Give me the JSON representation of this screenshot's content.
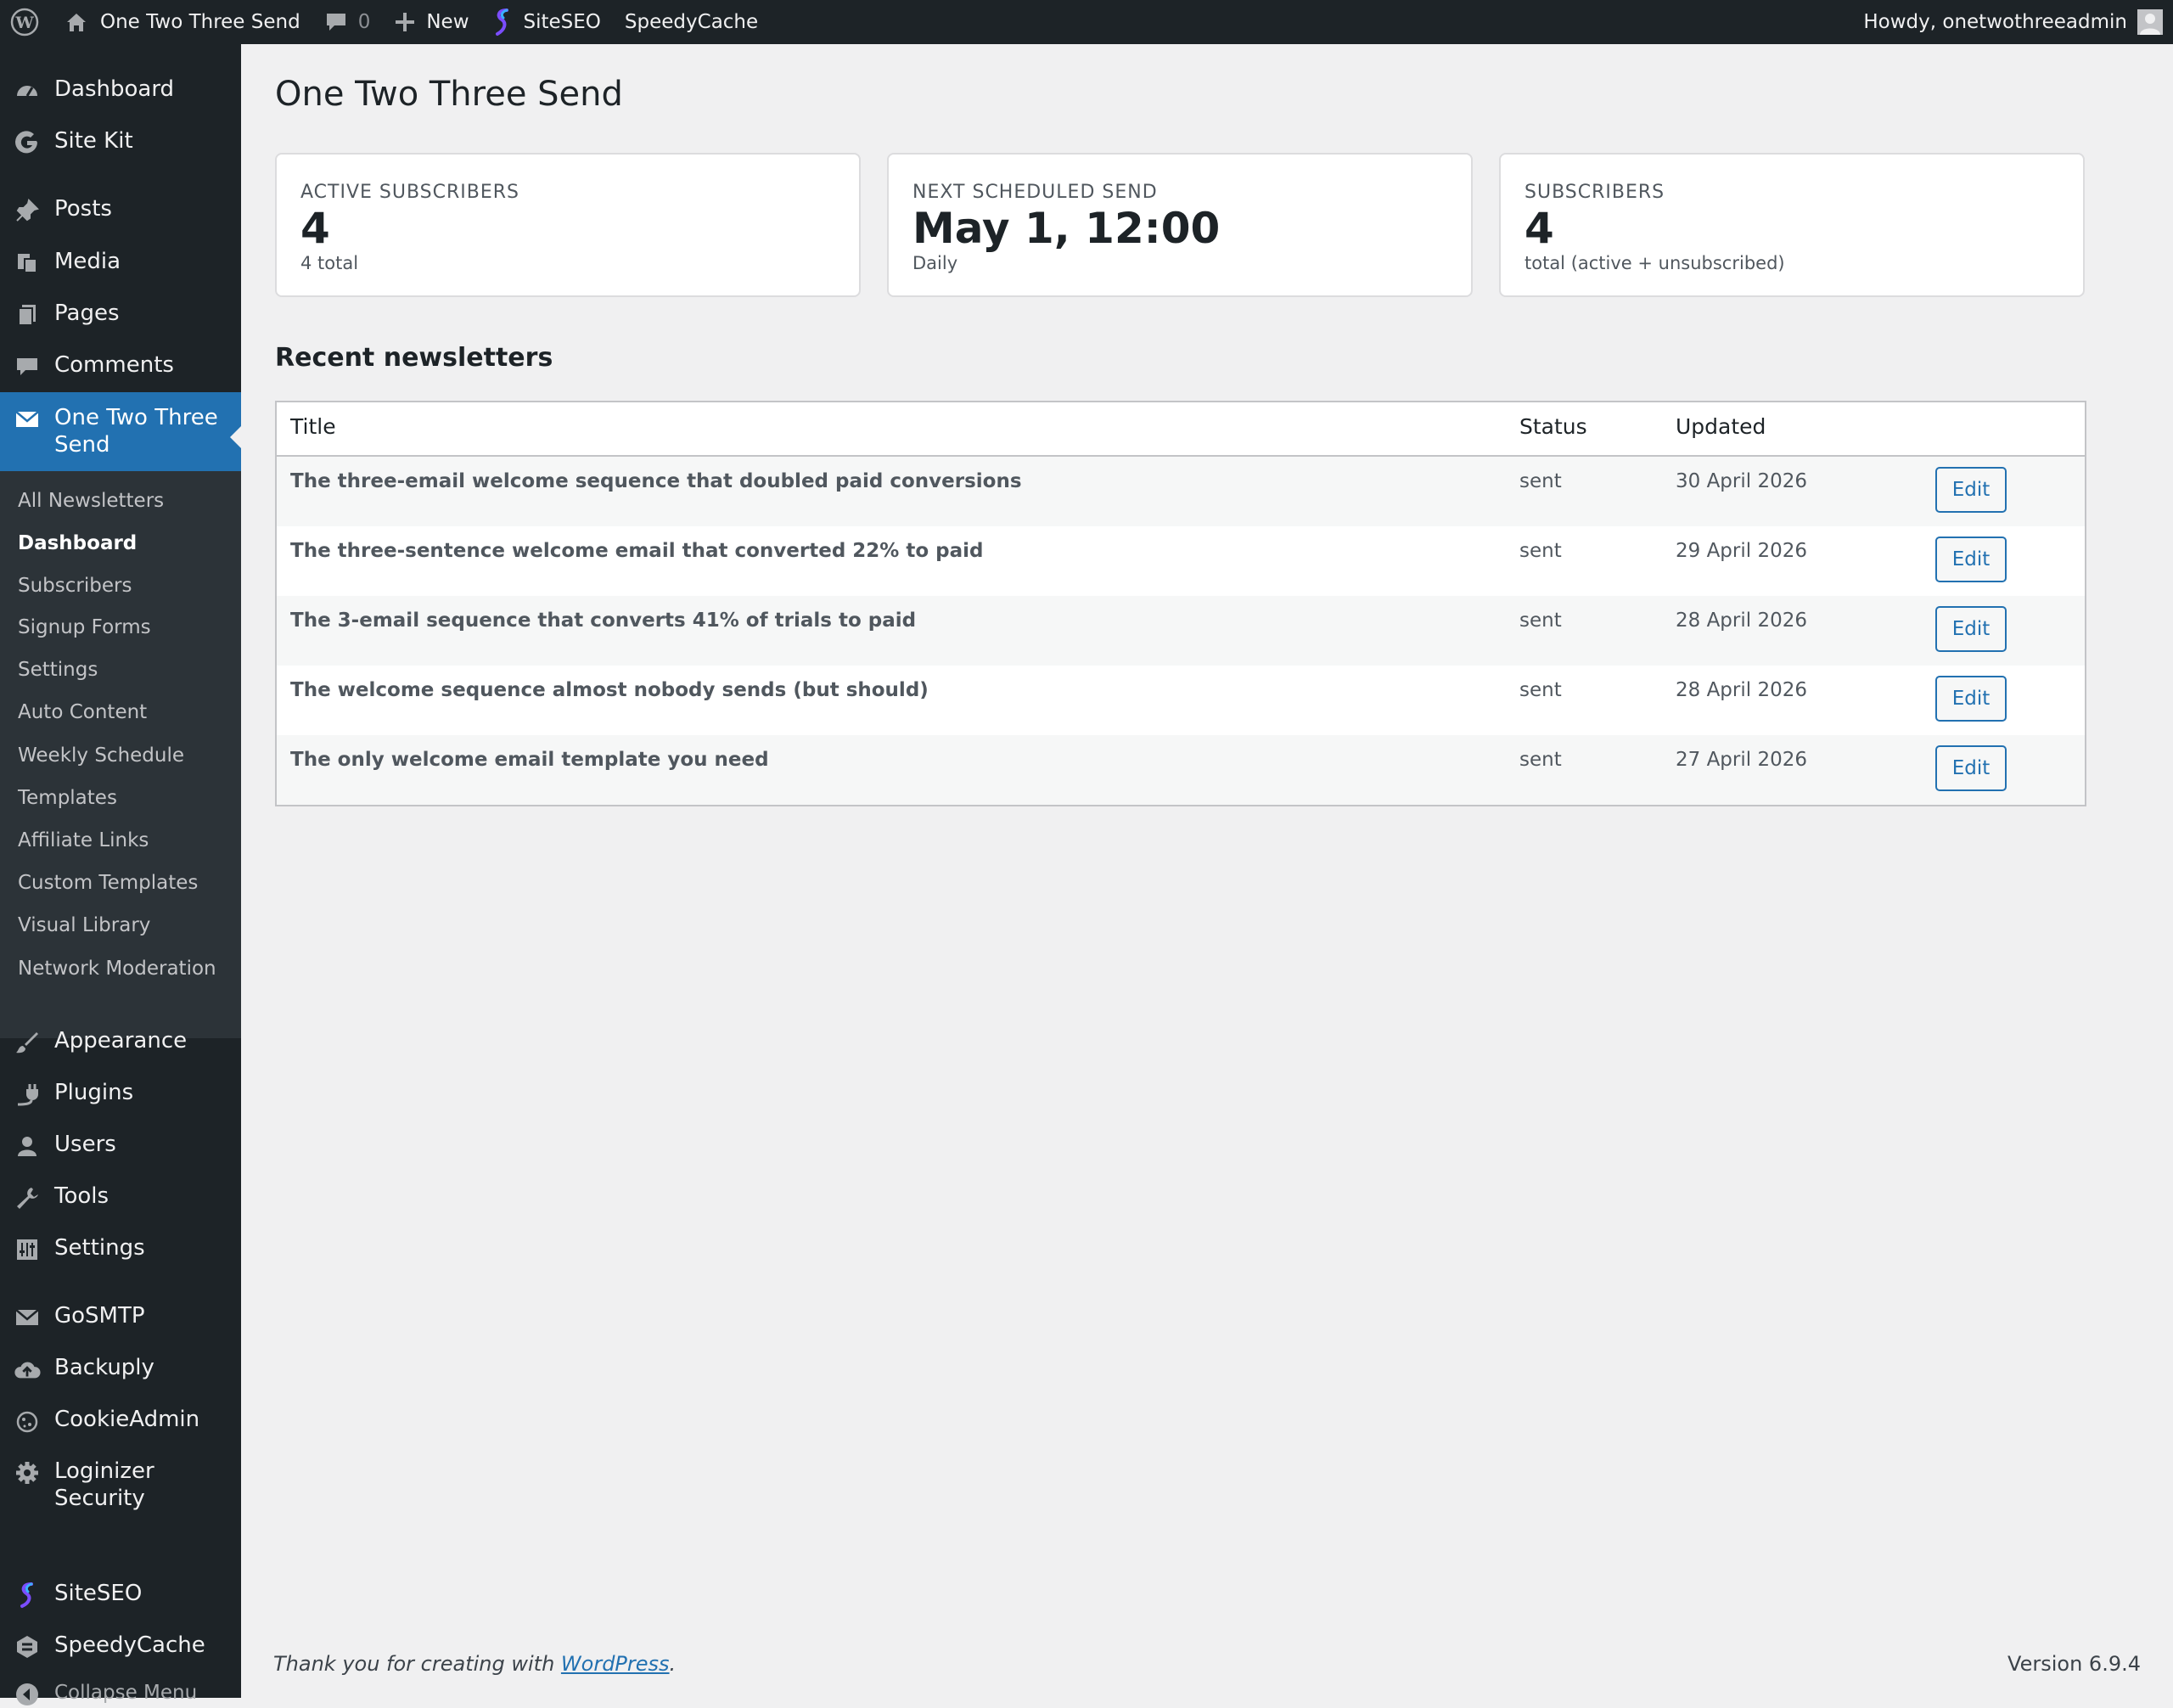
{
  "adminbar": {
    "site_name": "One Two Three Send",
    "comments_count": "0",
    "new_label": "New",
    "siteseo_label": "SiteSEO",
    "speedycache_label": "SpeedyCache",
    "greeting": "Howdy, onetwothreeadmin"
  },
  "sidebar": {
    "items_top": [
      {
        "label": "Dashboard",
        "icon": "dashboard-icon"
      },
      {
        "label": "Site Kit",
        "icon": "google-g-icon"
      },
      {
        "label": "Posts",
        "icon": "pushpin-icon"
      },
      {
        "label": "Media",
        "icon": "media-icon"
      },
      {
        "label": "Pages",
        "icon": "pages-icon"
      },
      {
        "label": "Comments",
        "icon": "comment-icon"
      },
      {
        "label": "One Two Three Send",
        "icon": "envelope-icon"
      }
    ],
    "submenu": [
      "All Newsletters",
      "Dashboard",
      "Subscribers",
      "Signup Forms",
      "Settings",
      "Auto Content",
      "Weekly Schedule",
      "Templates",
      "Affiliate Links",
      "Custom Templates",
      "Visual Library",
      "Network Moderation"
    ],
    "items_bottom": [
      {
        "label": "Appearance",
        "icon": "brush-icon"
      },
      {
        "label": "Plugins",
        "icon": "plug-icon"
      },
      {
        "label": "Users",
        "icon": "user-icon"
      },
      {
        "label": "Tools",
        "icon": "wrench-icon"
      },
      {
        "label": "Settings",
        "icon": "settings-icon"
      },
      {
        "label": "GoSMTP",
        "icon": "mail-icon"
      },
      {
        "label": "Backuply",
        "icon": "cloud-upload-icon"
      },
      {
        "label": "CookieAdmin",
        "icon": "cookie-icon"
      },
      {
        "label": "Loginizer Security",
        "icon": "gear-icon"
      },
      {
        "label": "SiteSEO",
        "icon": "siteseo-icon"
      },
      {
        "label": "SpeedyCache",
        "icon": "speedycache-icon"
      }
    ],
    "collapse": "Collapse Menu"
  },
  "main": {
    "title": "One Two Three Send",
    "cards": [
      {
        "label": "ACTIVE SUBSCRIBERS",
        "value": "4",
        "sub": "4 total"
      },
      {
        "label": "NEXT SCHEDULED SEND",
        "value": "May 1, 12:00",
        "sub": "Daily"
      },
      {
        "label": "SUBSCRIBERS",
        "value": "4",
        "sub": "total (active + unsubscribed)"
      }
    ],
    "recent_title": "Recent newsletters",
    "table": {
      "headers": [
        "Title",
        "Status",
        "Updated"
      ],
      "rows": [
        {
          "title": "The three-email welcome sequence that doubled paid conversions",
          "status": "sent",
          "updated": "30 April 2026",
          "action": "Edit"
        },
        {
          "title": "The three-sentence welcome email that converted 22% to paid",
          "status": "sent",
          "updated": "29 April 2026",
          "action": "Edit"
        },
        {
          "title": "The 3-email sequence that converts 41% of trials to paid",
          "status": "sent",
          "updated": "28 April 2026",
          "action": "Edit"
        },
        {
          "title": "The welcome sequence almost nobody sends (but should)",
          "status": "sent",
          "updated": "28 April 2026",
          "action": "Edit"
        },
        {
          "title": "The only welcome email template you need",
          "status": "sent",
          "updated": "27 April 2026",
          "action": "Edit"
        }
      ]
    }
  },
  "footer": {
    "thanks_prefix": "Thank you for creating with ",
    "thanks_link": "WordPress",
    "thanks_suffix": ".",
    "version": "Version 6.9.4"
  }
}
